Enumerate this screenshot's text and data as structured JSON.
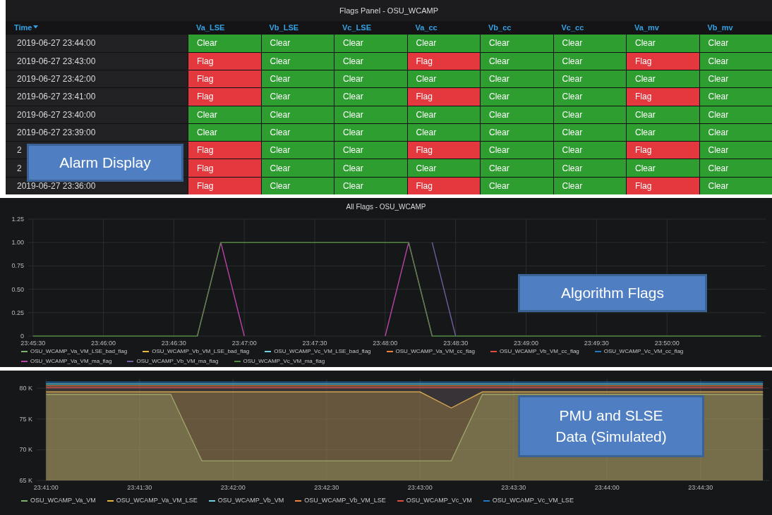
{
  "flags_panel": {
    "title": "Flags Panel - OSU_WCAMP",
    "columns": [
      {
        "label": "Time",
        "sorted": true
      },
      {
        "label": "Va_LSE",
        "sorted": false
      },
      {
        "label": "Vb_LSE",
        "sorted": false
      },
      {
        "label": "Vc_LSE",
        "sorted": false
      },
      {
        "label": "Va_cc",
        "sorted": false
      },
      {
        "label": "Vb_cc",
        "sorted": false
      },
      {
        "label": "Vc_cc",
        "sorted": false
      },
      {
        "label": "Va_mv",
        "sorted": false
      },
      {
        "label": "Vb_mv",
        "sorted": false
      }
    ],
    "rows": [
      {
        "cells": [
          {
            "text": "2019-06-27 23:44:00"
          },
          {
            "text": "Clear",
            "color": "#2f9e31"
          },
          {
            "text": "Clear",
            "color": "#2f9e31"
          },
          {
            "text": "Clear",
            "color": "#2f9e31"
          },
          {
            "text": "Clear",
            "color": "#2f9e31"
          },
          {
            "text": "Clear",
            "color": "#2f9e31"
          },
          {
            "text": "Clear",
            "color": "#2f9e31"
          },
          {
            "text": "Clear",
            "color": "#2f9e31"
          },
          {
            "text": "Clear",
            "color": "#2f9e31"
          }
        ]
      },
      {
        "cells": [
          {
            "text": "2019-06-27 23:43:00"
          },
          {
            "text": "Flag",
            "color": "#e3383d"
          },
          {
            "text": "Clear",
            "color": "#2f9e31"
          },
          {
            "text": "Clear",
            "color": "#2f9e31"
          },
          {
            "text": "Flag",
            "color": "#e3383d"
          },
          {
            "text": "Clear",
            "color": "#2f9e31"
          },
          {
            "text": "Clear",
            "color": "#2f9e31"
          },
          {
            "text": "Flag",
            "color": "#e3383d"
          },
          {
            "text": "Clear",
            "color": "#2f9e31"
          }
        ]
      },
      {
        "cells": [
          {
            "text": "2019-06-27 23:42:00"
          },
          {
            "text": "Flag",
            "color": "#e3383d"
          },
          {
            "text": "Clear",
            "color": "#2f9e31"
          },
          {
            "text": "Clear",
            "color": "#2f9e31"
          },
          {
            "text": "Clear",
            "color": "#2f9e31"
          },
          {
            "text": "Clear",
            "color": "#2f9e31"
          },
          {
            "text": "Clear",
            "color": "#2f9e31"
          },
          {
            "text": "Clear",
            "color": "#2f9e31"
          },
          {
            "text": "Clear",
            "color": "#2f9e31"
          }
        ]
      },
      {
        "cells": [
          {
            "text": "2019-06-27 23:41:00"
          },
          {
            "text": "Flag",
            "color": "#e3383d"
          },
          {
            "text": "Clear",
            "color": "#2f9e31"
          },
          {
            "text": "Clear",
            "color": "#2f9e31"
          },
          {
            "text": "Flag",
            "color": "#e3383d"
          },
          {
            "text": "Clear",
            "color": "#2f9e31"
          },
          {
            "text": "Clear",
            "color": "#2f9e31"
          },
          {
            "text": "Flag",
            "color": "#e3383d"
          },
          {
            "text": "Clear",
            "color": "#2f9e31"
          }
        ]
      },
      {
        "cells": [
          {
            "text": "2019-06-27 23:40:00"
          },
          {
            "text": "Clear",
            "color": "#2f9e31"
          },
          {
            "text": "Clear",
            "color": "#2f9e31"
          },
          {
            "text": "Clear",
            "color": "#2f9e31"
          },
          {
            "text": "Clear",
            "color": "#2f9e31"
          },
          {
            "text": "Clear",
            "color": "#2f9e31"
          },
          {
            "text": "Clear",
            "color": "#2f9e31"
          },
          {
            "text": "Clear",
            "color": "#2f9e31"
          },
          {
            "text": "Clear",
            "color": "#2f9e31"
          }
        ]
      },
      {
        "cells": [
          {
            "text": "2019-06-27 23:39:00"
          },
          {
            "text": "Clear",
            "color": "#2f9e31"
          },
          {
            "text": "Clear",
            "color": "#2f9e31"
          },
          {
            "text": "Clear",
            "color": "#2f9e31"
          },
          {
            "text": "Clear",
            "color": "#2f9e31"
          },
          {
            "text": "Clear",
            "color": "#2f9e31"
          },
          {
            "text": "Clear",
            "color": "#2f9e31"
          },
          {
            "text": "Clear",
            "color": "#2f9e31"
          },
          {
            "text": "Clear",
            "color": "#2f9e31"
          }
        ]
      },
      {
        "cells": [
          {
            "text": "2"
          },
          {
            "text": "Flag",
            "color": "#e3383d"
          },
          {
            "text": "Clear",
            "color": "#2f9e31"
          },
          {
            "text": "Clear",
            "color": "#2f9e31"
          },
          {
            "text": "Flag",
            "color": "#e3383d"
          },
          {
            "text": "Clear",
            "color": "#2f9e31"
          },
          {
            "text": "Clear",
            "color": "#2f9e31"
          },
          {
            "text": "Flag",
            "color": "#e3383d"
          },
          {
            "text": "Clear",
            "color": "#2f9e31"
          }
        ]
      },
      {
        "cells": [
          {
            "text": "2"
          },
          {
            "text": "Flag",
            "color": "#e3383d"
          },
          {
            "text": "Clear",
            "color": "#2f9e31"
          },
          {
            "text": "Clear",
            "color": "#2f9e31"
          },
          {
            "text": "Clear",
            "color": "#2f9e31"
          },
          {
            "text": "Clear",
            "color": "#2f9e31"
          },
          {
            "text": "Clear",
            "color": "#2f9e31"
          },
          {
            "text": "Clear",
            "color": "#2f9e31"
          },
          {
            "text": "Clear",
            "color": "#2f9e31"
          }
        ]
      },
      {
        "cells": [
          {
            "text": "2019-06-27 23:36:00"
          },
          {
            "text": "Flag",
            "color": "#e3383d"
          },
          {
            "text": "Clear",
            "color": "#2f9e31"
          },
          {
            "text": "Clear",
            "color": "#2f9e31"
          },
          {
            "text": "Flag",
            "color": "#e3383d"
          },
          {
            "text": "Clear",
            "color": "#2f9e31"
          },
          {
            "text": "Clear",
            "color": "#2f9e31"
          },
          {
            "text": "Flag",
            "color": "#e3383d"
          },
          {
            "text": "Clear",
            "color": "#2f9e31"
          }
        ]
      }
    ],
    "callout": "Alarm Display"
  },
  "flags_chart": {
    "title": "All Flags - OSU_WCAMP",
    "callout": "Algorithm Flags",
    "chart_data": {
      "type": "line",
      "grid": true,
      "ylim": [
        0,
        1.25
      ],
      "categories": [
        "23:45:30",
        null,
        null,
        "23:46:00",
        null,
        null,
        "23:46:30",
        null,
        null,
        "23:47:00",
        null,
        null,
        "23:47:30",
        null,
        null,
        "23:48:00",
        null,
        null,
        "23:48:30",
        null,
        null,
        "23:49:00",
        null,
        null,
        "23:49:30",
        null,
        null,
        "23:50:00",
        null,
        null,
        null,
        null
      ],
      "yticks": [
        {
          "value": 0,
          "label": "0"
        },
        {
          "value": 0.25,
          "label": "0.25"
        },
        {
          "value": 0.5,
          "label": "0.50"
        },
        {
          "value": 0.75,
          "label": "0.75"
        },
        {
          "value": 1,
          "label": "1.00"
        },
        {
          "value": 1.25,
          "label": "1.25"
        }
      ],
      "series": [
        {
          "name": "OSU_WCAMP_Va_VM_LSE_bad_flag",
          "color": "#7eb26d",
          "values": [
            null,
            null,
            null,
            null,
            null,
            null,
            null,
            null,
            null,
            null,
            null,
            null,
            null,
            null,
            null,
            null,
            null,
            null,
            null,
            null,
            null,
            null,
            null,
            null,
            null,
            null,
            null,
            null,
            null,
            null,
            null,
            null
          ]
        },
        {
          "name": "OSU_WCAMP_Vb_VM_LSE_bad_flag",
          "color": "#eab839",
          "values": [
            null,
            null,
            null,
            null,
            null,
            null,
            null,
            null,
            null,
            null,
            null,
            null,
            null,
            null,
            null,
            null,
            null,
            null,
            null,
            null,
            null,
            null,
            null,
            null,
            null,
            null,
            null,
            null,
            null,
            null,
            null,
            null
          ]
        },
        {
          "name": "OSU_WCAMP_Vc_VM_LSE_bad_flag",
          "color": "#6ed0e0",
          "values": [
            null,
            null,
            null,
            null,
            null,
            null,
            null,
            null,
            null,
            null,
            null,
            null,
            null,
            null,
            null,
            null,
            null,
            null,
            null,
            null,
            null,
            null,
            null,
            null,
            null,
            null,
            null,
            null,
            null,
            null,
            null,
            null
          ]
        },
        {
          "name": "OSU_WCAMP_Va_VM_cc_flag",
          "color": "#ef843c",
          "values": [
            null,
            null,
            null,
            null,
            null,
            null,
            null,
            null,
            null,
            null,
            null,
            null,
            null,
            null,
            null,
            null,
            null,
            null,
            null,
            null,
            null,
            null,
            null,
            null,
            null,
            null,
            null,
            null,
            null,
            null,
            null,
            null
          ]
        },
        {
          "name": "OSU_WCAMP_Vb_VM_cc_flag",
          "color": "#e24d42",
          "values": [
            null,
            null,
            null,
            null,
            null,
            null,
            null,
            null,
            null,
            null,
            null,
            null,
            null,
            null,
            null,
            null,
            null,
            null,
            null,
            null,
            null,
            null,
            null,
            null,
            null,
            null,
            null,
            null,
            null,
            null,
            null,
            null
          ]
        },
        {
          "name": "OSU_WCAMP_Vc_VM_cc_flag",
          "color": "#1f78c1",
          "values": [
            null,
            null,
            null,
            null,
            null,
            null,
            null,
            null,
            null,
            null,
            null,
            null,
            null,
            null,
            null,
            null,
            null,
            null,
            null,
            null,
            null,
            null,
            null,
            null,
            null,
            null,
            null,
            null,
            null,
            null,
            null,
            null
          ]
        },
        {
          "name": "OSU_WCAMP_Va_VM_ma_flag",
          "color": "#ba43a9",
          "values": [
            null,
            null,
            null,
            null,
            null,
            null,
            null,
            0,
            1,
            0,
            null,
            null,
            null,
            null,
            null,
            0,
            1,
            0,
            null,
            null,
            null,
            null,
            null,
            null,
            null,
            null,
            null,
            null,
            null,
            null,
            null,
            null
          ]
        },
        {
          "name": "OSU_WCAMP_Vb_VM_ma_flag",
          "color": "#705da0",
          "values": [
            null,
            null,
            null,
            null,
            null,
            null,
            null,
            null,
            null,
            null,
            null,
            null,
            null,
            null,
            null,
            null,
            null,
            1,
            0,
            null,
            null,
            null,
            null,
            null,
            null,
            null,
            null,
            null,
            null,
            null,
            null,
            null
          ]
        },
        {
          "name": "OSU_WCAMP_Vc_VM_ma_flag",
          "color": "#508642",
          "values": [
            0,
            0,
            0,
            0,
            0,
            0,
            0,
            0,
            1,
            1,
            1,
            1,
            1,
            1,
            1,
            1,
            1,
            0,
            0,
            0,
            0,
            0,
            0,
            0,
            0,
            0,
            0,
            0,
            0,
            0,
            0,
            0
          ]
        }
      ]
    }
  },
  "data_chart": {
    "callout": "PMU and SLSE Data (Simulated)",
    "chart_data": {
      "type": "area",
      "grid": true,
      "ylim": [
        65000,
        81500
      ],
      "categories": [
        "23:41:00",
        null,
        null,
        "23:41:30",
        null,
        null,
        "23:42:00",
        null,
        null,
        "23:42:30",
        null,
        null,
        "23:43:00",
        null,
        null,
        "23:43:30",
        null,
        null,
        "23:44:00",
        null,
        null,
        "23:44:30",
        null,
        null
      ],
      "yticks": [
        {
          "value": 65000,
          "label": "65 K"
        },
        {
          "value": 70000,
          "label": "70 K"
        },
        {
          "value": 75000,
          "label": "75 K"
        },
        {
          "value": 80000,
          "label": "80 K"
        }
      ],
      "series": [
        {
          "name": "OSU_WCAMP_Va_VM",
          "color": "#7eb26d",
          "values": [
            79000,
            79000,
            79000,
            79000,
            79000,
            68200,
            68200,
            68200,
            68200,
            68200,
            68200,
            68200,
            68200,
            68200,
            79000,
            79000,
            79000,
            79000,
            79000,
            79000,
            79000,
            79000,
            79000,
            79000
          ]
        },
        {
          "name": "OSU_WCAMP_Va_VM_LSE",
          "color": "#eab839",
          "values": [
            79400,
            79400,
            79400,
            79400,
            79400,
            79400,
            79400,
            79400,
            79400,
            79400,
            79400,
            79400,
            79400,
            76800,
            79400,
            79400,
            79400,
            79400,
            79400,
            79400,
            79400,
            79400,
            79400,
            79400
          ]
        },
        {
          "name": "OSU_WCAMP_Vb_VM",
          "color": "#6ed0e0",
          "values": [
            80700,
            80700,
            80700,
            80700,
            80700,
            80700,
            80700,
            80700,
            80700,
            80700,
            80700,
            80700,
            80700,
            80700,
            80700,
            80700,
            80700,
            80700,
            80700,
            80700,
            80700,
            80700,
            80700,
            80700
          ]
        },
        {
          "name": "OSU_WCAMP_Vb_VM_LSE",
          "color": "#ef843c",
          "values": [
            80400,
            80400,
            80400,
            80400,
            80400,
            80400,
            80400,
            80400,
            80400,
            80400,
            80400,
            80400,
            80400,
            80400,
            80400,
            80400,
            80400,
            80400,
            80400,
            80400,
            80400,
            80400,
            80400,
            80400
          ]
        },
        {
          "name": "OSU_WCAMP_Vc_VM",
          "color": "#e24d42",
          "values": [
            80100,
            80100,
            80100,
            80100,
            80100,
            80100,
            80100,
            80100,
            80100,
            80100,
            80100,
            80100,
            80100,
            80100,
            80100,
            80100,
            80100,
            80100,
            80100,
            80100,
            80100,
            80100,
            80100,
            80100
          ]
        },
        {
          "name": "OSU_WCAMP_Vc_VM_LSE",
          "color": "#1f78c1",
          "values": [
            81000,
            81000,
            81000,
            81000,
            81000,
            81000,
            81000,
            81000,
            81000,
            81000,
            81000,
            81000,
            81000,
            81000,
            81000,
            81000,
            81000,
            81000,
            81000,
            81000,
            81000,
            81000,
            81000,
            81000
          ]
        }
      ]
    }
  }
}
